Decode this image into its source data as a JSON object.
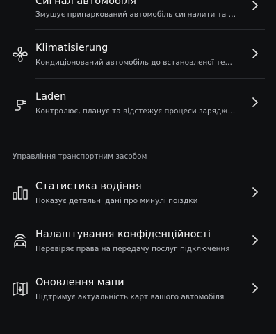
{
  "rows_top": [
    {
      "title": "Сигнал автомобіля",
      "subtitle": "Змушує припаркований автомобіль сигналити та блима...",
      "icon": "car-signal-icon"
    },
    {
      "title": "Klimatisierung",
      "subtitle": "Кондиціонований автомобіль до встановленої темпера...",
      "icon": "fan-icon"
    },
    {
      "title": "Laden",
      "subtitle": "Контролює, планує та відстежує процеси заряджання",
      "icon": "charging-plug-icon"
    }
  ],
  "section_header": "Управління транспортним засобом",
  "rows_bottom": [
    {
      "title": "Статистика водіння",
      "subtitle": "Показує детальні дані про минулі поїздки",
      "icon": "bar-chart-icon"
    },
    {
      "title": "Налаштування конфіденційності",
      "subtitle": "Перевіряє права на передачу послуг підключення",
      "icon": "car-privacy-icon"
    },
    {
      "title": "Оновлення мапи",
      "subtitle": "Підтримує актуальність карт вашого автомобіля",
      "icon": "map-update-icon"
    }
  ],
  "colors": {
    "background": "#0f1012",
    "title": "#f2f2f2",
    "subtitle": "#b9bcc2",
    "divider": "#2a2c30"
  }
}
